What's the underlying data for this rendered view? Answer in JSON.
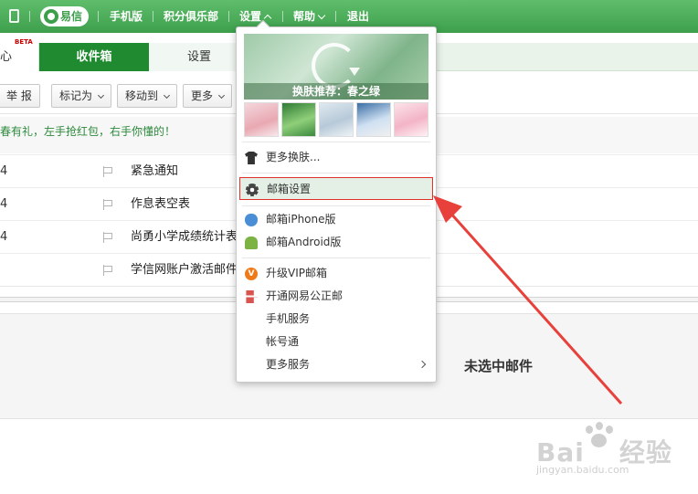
{
  "topbar": {
    "yixin_label": "易信",
    "mobile_label": "手机版",
    "points_club_label": "积分俱乐部",
    "settings_label": "设置",
    "help_label": "帮助",
    "logout_label": "退出"
  },
  "tabs": {
    "first_partial": "心",
    "first_badge": "BETA",
    "inbox": "收件箱",
    "settings": "设置"
  },
  "toolbar": {
    "report": "举 报",
    "mark_as": "标记为",
    "move_to": "移动到",
    "more": "更多"
  },
  "notice": "春有礼，左手抢红包，右手你懂的！",
  "mails": [
    {
      "date": "4",
      "subject": "紧急通知"
    },
    {
      "date": "4",
      "subject": "作息表空表"
    },
    {
      "date": "4",
      "subject": "尚勇小学成绩统计表"
    },
    {
      "date": "",
      "subject": "学信网账户激活邮件"
    }
  ],
  "preview": {
    "empty_text": "未选中邮件"
  },
  "settings_menu": {
    "skin_caption": "换肤推荐：春之绿",
    "more_skins": "更多换肤...",
    "mailbox_settings": "邮箱设置",
    "iphone": "邮箱iPhone版",
    "android": "邮箱Android版",
    "vip": "升级VIP邮箱",
    "notary": "开通网易公正邮",
    "mobile_service": "手机服务",
    "account": "帐号通",
    "more_services": "更多服务"
  },
  "watermark": {
    "brand": "Bai",
    "brand_suffix": "经验",
    "url": "jingyan.baidu.com"
  },
  "colors": {
    "brand_green": "#3d9f4c",
    "inbox_tab": "#1f8a2f",
    "highlight_border": "#e0302b",
    "annotation_arrow": "#e8403a"
  }
}
